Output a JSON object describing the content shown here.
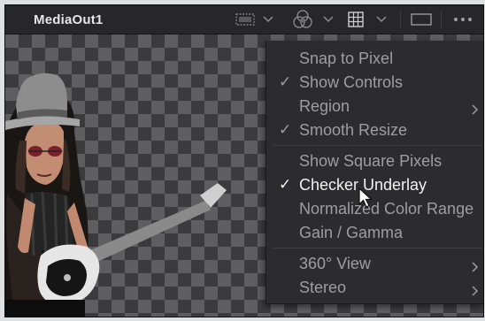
{
  "viewer": {
    "title": "MediaOut1"
  },
  "toolbar": {
    "icons": [
      "roi-icon",
      "chevron-down-icon",
      "color-channels-icon",
      "chevron-down-icon",
      "grid-icon",
      "chevron-down-icon",
      "aspect-rect-icon",
      "more-options-icon"
    ]
  },
  "menu": {
    "items": [
      {
        "label": "Snap to Pixel",
        "checked": false,
        "submenu": false
      },
      {
        "label": "Show Controls",
        "checked": true,
        "submenu": false
      },
      {
        "label": "Region",
        "checked": false,
        "submenu": true
      },
      {
        "label": "Smooth Resize",
        "checked": true,
        "submenu": false
      },
      {
        "label": "Show Square Pixels",
        "checked": false,
        "submenu": false
      },
      {
        "label": "Checker Underlay",
        "checked": true,
        "submenu": false,
        "active": true
      },
      {
        "label": "Normalized Color Range",
        "checked": false,
        "submenu": false
      },
      {
        "label": "Gain / Gamma",
        "checked": false,
        "submenu": false
      },
      {
        "label": "360° View",
        "checked": false,
        "submenu": true
      },
      {
        "label": "Stereo",
        "checked": false,
        "submenu": true
      }
    ],
    "check_glyph": "✓"
  },
  "colors": {
    "menu_bg": "#2c2c2e",
    "active_text": "#f2f2f2",
    "text": "#9e9e9e",
    "checker_dark": "#3b3b3d",
    "checker_light": "#5e5e60"
  }
}
